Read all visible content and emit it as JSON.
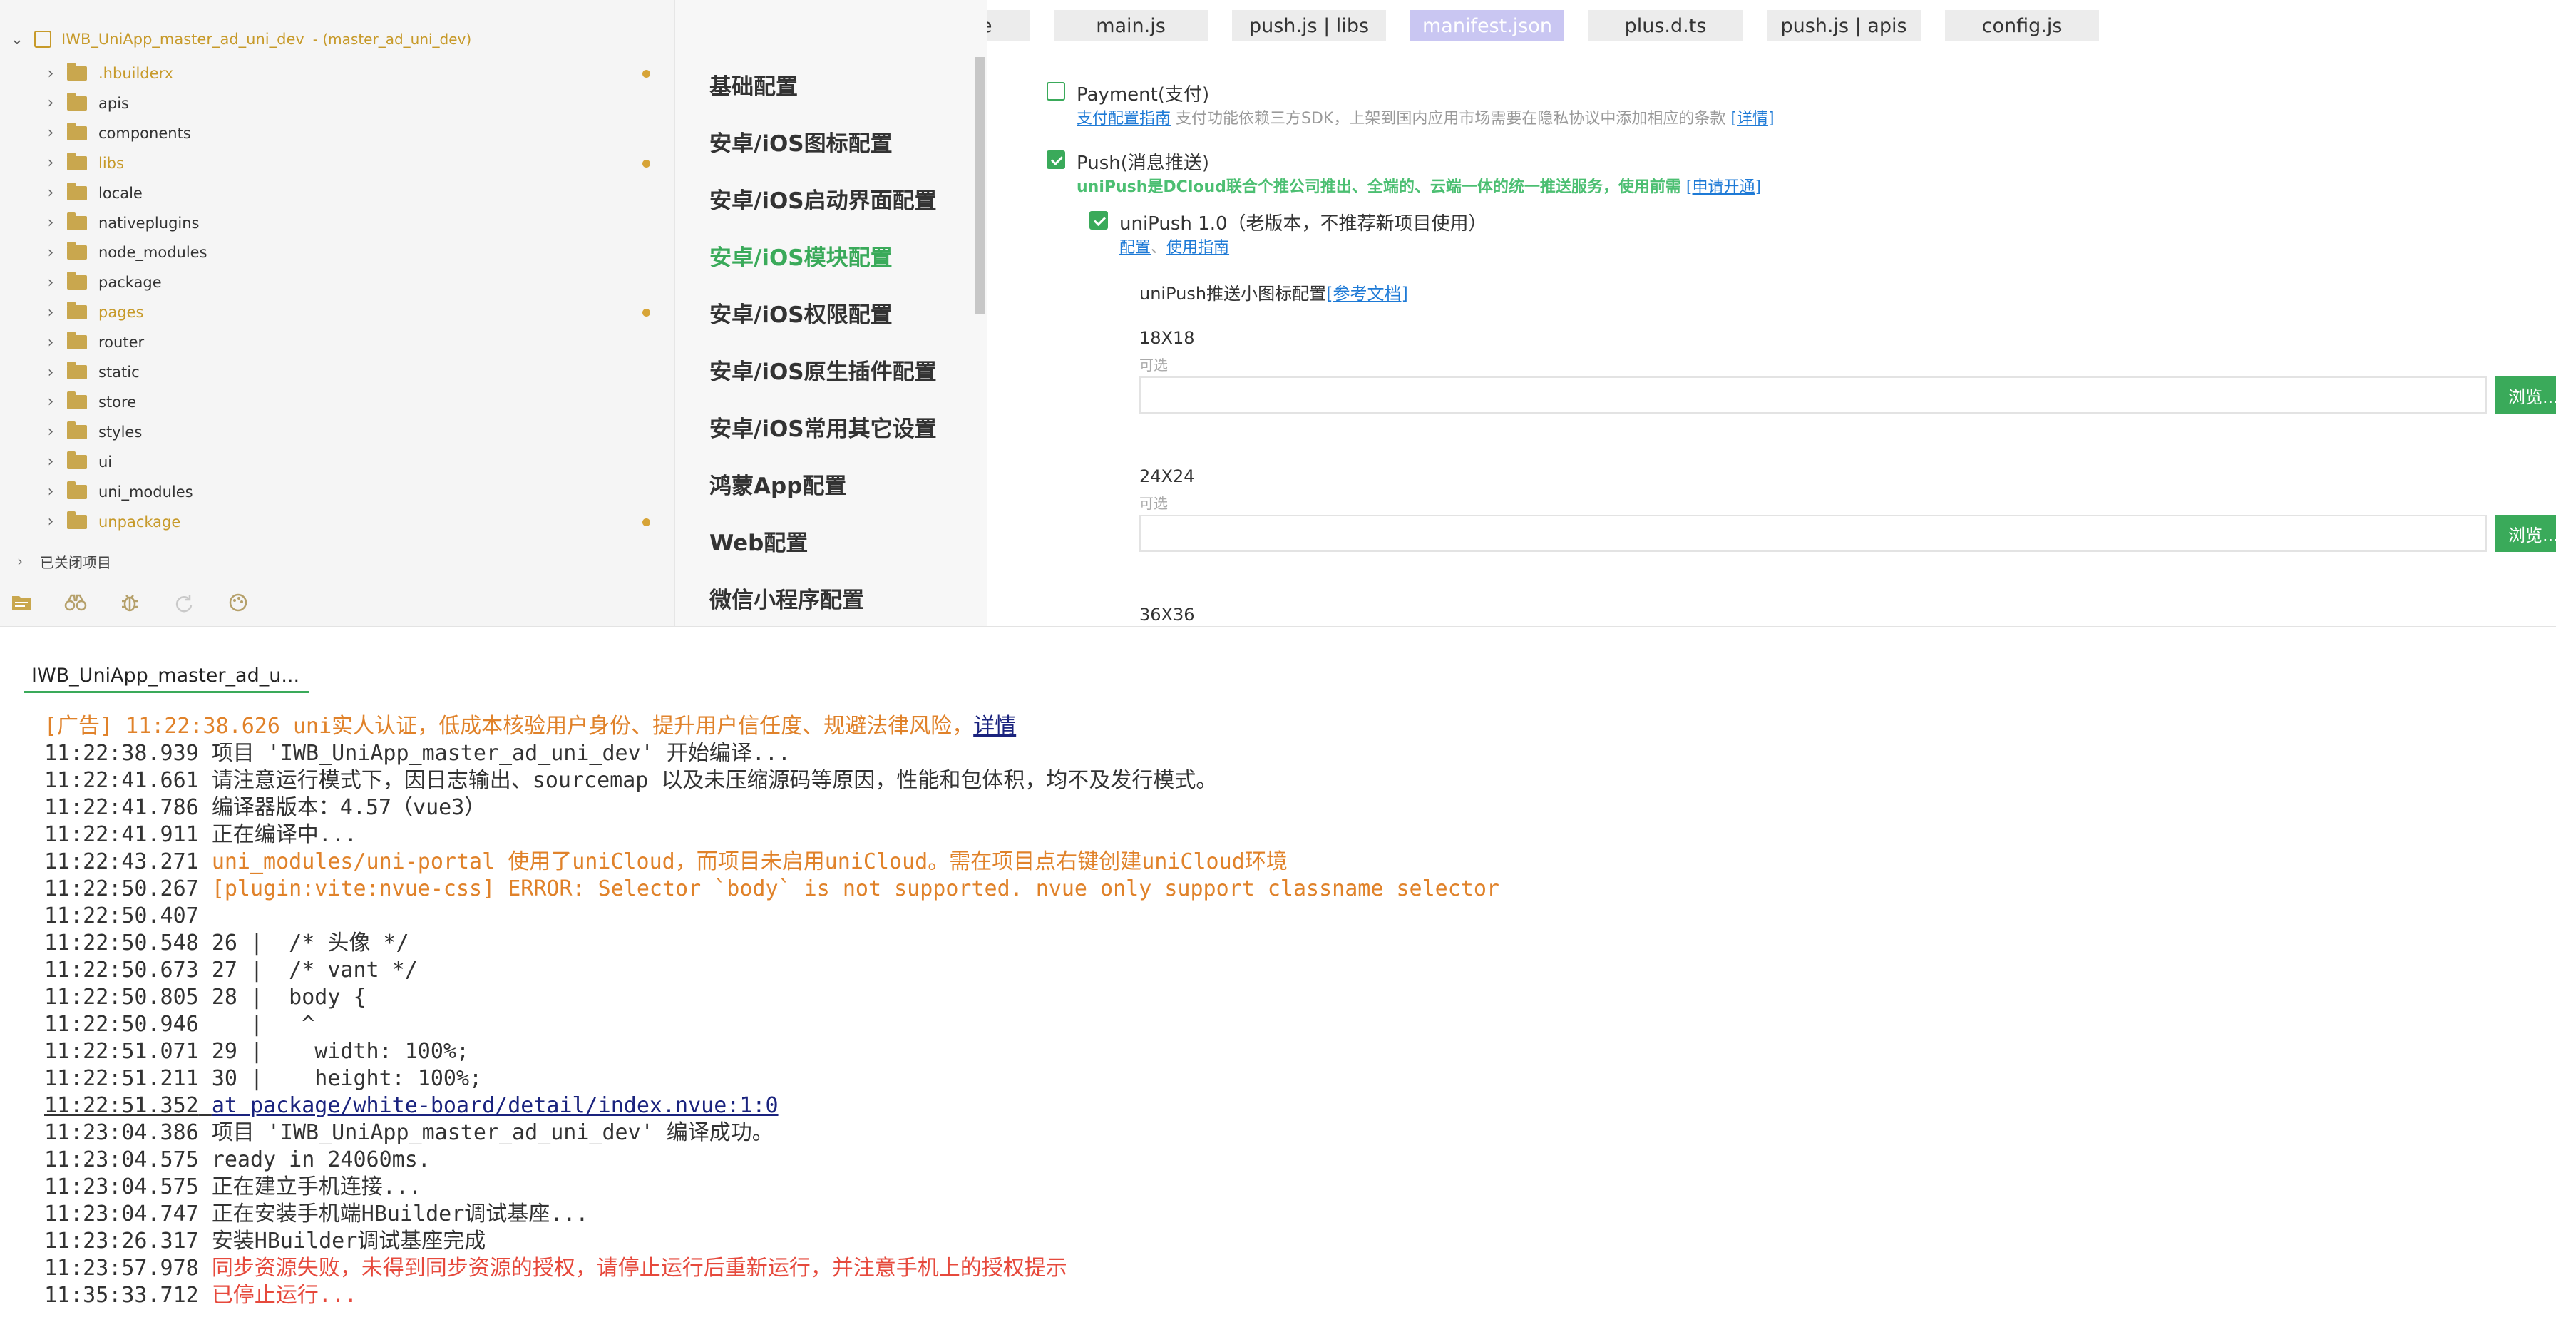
{
  "explorer": {
    "project_name": "IWB_UniApp_master_ad_uni_dev",
    "project_branch": "- (master_ad_uni_dev)",
    "items": [
      {
        "label": ".hbuilderx",
        "modified": true
      },
      {
        "label": "apis",
        "modified": false
      },
      {
        "label": "components",
        "modified": false
      },
      {
        "label": "libs",
        "modified": true
      },
      {
        "label": "locale",
        "modified": false
      },
      {
        "label": "nativeplugins",
        "modified": false
      },
      {
        "label": "node_modules",
        "modified": false
      },
      {
        "label": "package",
        "modified": false
      },
      {
        "label": "pages",
        "modified": true
      },
      {
        "label": "router",
        "modified": false
      },
      {
        "label": "static",
        "modified": false
      },
      {
        "label": "store",
        "modified": false
      },
      {
        "label": "styles",
        "modified": false
      },
      {
        "label": "ui",
        "modified": false
      },
      {
        "label": "uni_modules",
        "modified": false
      },
      {
        "label": "unpackage",
        "modified": true
      }
    ],
    "closed_projects_label": "已关闭项目",
    "toolbar_icons": [
      "folder-icon",
      "binoculars-icon",
      "bug-icon",
      "refresh-search-icon",
      "palette-icon"
    ]
  },
  "tabs": [
    {
      "label": "App.vue",
      "active": false
    },
    {
      "label": "App.vue",
      "active": false
    },
    {
      "label": "main.js",
      "active": false
    },
    {
      "label": "push.js | libs",
      "active": false
    },
    {
      "label": "manifest.json",
      "active": true
    },
    {
      "label": "plus.d.ts",
      "active": false
    },
    {
      "label": "push.js | apis",
      "active": false
    },
    {
      "label": "config.js",
      "active": false
    }
  ],
  "settings_nav": [
    {
      "label": "基础配置",
      "active": false
    },
    {
      "label": "安卓/iOS图标配置",
      "active": false
    },
    {
      "label": "安卓/iOS启动界面配置",
      "active": false
    },
    {
      "label": "安卓/iOS模块配置",
      "active": true
    },
    {
      "label": "安卓/iOS权限配置",
      "active": false
    },
    {
      "label": "安卓/iOS原生插件配置",
      "active": false
    },
    {
      "label": "安卓/iOS常用其它设置",
      "active": false
    },
    {
      "label": "鸿蒙App配置",
      "active": false
    },
    {
      "label": "Web配置",
      "active": false
    },
    {
      "label": "微信小程序配置",
      "active": false
    }
  ],
  "content": {
    "payment": {
      "label": "Payment(支付)",
      "checked": false,
      "guide_link": "支付配置指南",
      "note": "支付功能依赖三方SDK，上架到国内应用市场需要在隐私协议中添加相应的条款",
      "detail_link": "[详情]"
    },
    "push": {
      "label": "Push(消息推送)",
      "checked": true,
      "note_bold": "uniPush是DCloud联合个推公司推出、全端的、云端一体的统一推送服务，使用前需",
      "apply_link": "[申请开通]"
    },
    "unipush": {
      "label": "uniPush 1.0（老版本，不推荐新项目使用）",
      "checked": true,
      "config_link": "配置",
      "sep": "、",
      "guide_link": "使用指南"
    },
    "icon_config": {
      "label": "uniPush推送小图标配置",
      "doc_link": "[参考文档]"
    },
    "sizes": [
      {
        "label": "18X18",
        "hint": "可选",
        "value": "",
        "button": "浏览..."
      },
      {
        "label": "24X24",
        "hint": "可选",
        "value": "",
        "button": "浏览..."
      },
      {
        "label": "36X36",
        "hint": "",
        "value": "",
        "button": ""
      }
    ]
  },
  "console": {
    "tab_label": "IWB_UniApp_master_ad_u...",
    "lines": [
      {
        "type": "ad",
        "ts": "[广告] 11:22:38.626",
        "msg": "uni实人认证，低成本核验用户身份、提升用户信任度、规避法律风险，",
        "link": "详情"
      },
      {
        "type": "normal",
        "ts": "11:22:38.939",
        "msg": "项目 'IWB_UniApp_master_ad_uni_dev' 开始编译..."
      },
      {
        "type": "normal",
        "ts": "11:22:41.661",
        "msg": "请注意运行模式下，因日志输出、sourcemap 以及未压缩源码等原因，性能和包体积，均不及发行模式。"
      },
      {
        "type": "normal",
        "ts": "11:22:41.786",
        "msg": "编译器版本：4.57（vue3）"
      },
      {
        "type": "normal",
        "ts": "11:22:41.911",
        "msg": "正在编译中..."
      },
      {
        "type": "warn",
        "ts": "11:22:43.271",
        "msg": "uni_modules/uni-portal 使用了uniCloud，而项目未启用uniCloud。需在项目点右键创建uniCloud环境"
      },
      {
        "type": "warn",
        "ts": "11:22:50.267",
        "msg": "[plugin:vite:nvue-css] ERROR: Selector `body` is not supported. nvue only support classname selector"
      },
      {
        "type": "normal",
        "ts": "11:22:50.407",
        "msg": ""
      },
      {
        "type": "normal",
        "ts": "11:22:50.548",
        "msg": "26 |  /* 头像 */"
      },
      {
        "type": "normal",
        "ts": "11:22:50.673",
        "msg": "27 |  /* vant */"
      },
      {
        "type": "normal",
        "ts": "11:22:50.805",
        "msg": "28 |  body {"
      },
      {
        "type": "normal",
        "ts": "11:22:50.946",
        "msg": "   |   ^"
      },
      {
        "type": "normal",
        "ts": "11:22:51.071",
        "msg": "29 |    width: 100%;"
      },
      {
        "type": "normal",
        "ts": "11:22:51.211",
        "msg": "30 |    height: 100%;"
      },
      {
        "type": "link",
        "ts": "11:22:51.352",
        "msg": "at package/white-board/detail/index.nvue:1:0"
      },
      {
        "type": "normal",
        "ts": "11:23:04.386",
        "msg": "项目 'IWB_UniApp_master_ad_uni_dev' 编译成功。"
      },
      {
        "type": "normal",
        "ts": "11:23:04.575",
        "msg": "ready in 24060ms."
      },
      {
        "type": "normal",
        "ts": "11:23:04.575",
        "msg": "正在建立手机连接..."
      },
      {
        "type": "normal",
        "ts": "11:23:04.747",
        "msg": "正在安装手机端HBuilder调试基座..."
      },
      {
        "type": "normal",
        "ts": "11:23:26.317",
        "msg": "安装HBuilder调试基座完成"
      },
      {
        "type": "err",
        "ts": "11:23:57.978",
        "msg": "同步资源失败，未得到同步资源的授权，请停止运行后重新运行，并注意手机上的授权提示"
      },
      {
        "type": "err",
        "ts": "11:35:33.712",
        "msg": "已停止运行..."
      }
    ]
  },
  "colors": {
    "accent": "#3aaa5a",
    "warn": "#e0822a",
    "error": "#e6493c",
    "link": "#1e7ad6"
  }
}
